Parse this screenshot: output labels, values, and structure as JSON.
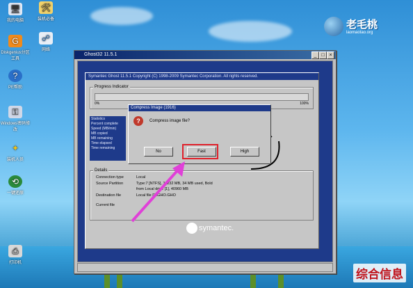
{
  "desktop": {
    "icons": [
      {
        "label": "我的电脑",
        "icon": "computer-icon"
      },
      {
        "label": "装机必备",
        "icon": "tools-icon"
      },
      {
        "label": "Diskgenius分区工具",
        "icon": "disk-icon"
      },
      {
        "label": "网络",
        "icon": "network-icon"
      },
      {
        "label": "PE帮助",
        "icon": "help-icon"
      },
      {
        "label": "Windows密码修改",
        "icon": "key-icon"
      },
      {
        "label": "装机人员",
        "icon": "user-icon"
      },
      {
        "label": "一键还原",
        "icon": "restore-icon"
      },
      {
        "label": "打印机",
        "icon": "printer-icon"
      }
    ]
  },
  "brand": {
    "name": "老毛桃",
    "url": "laomaotao.org"
  },
  "watermark": "综合信息",
  "window": {
    "title": "Ghost32 11.5.1",
    "header": "Symantec Ghost 11.5.1  Copyright (C) 1998-2009 Symantec Corporation. All rights reserved.",
    "progress_label": "Progress Indicator",
    "progress_start": "0%",
    "progress_end": "100%",
    "stats_title": "Statistics",
    "stats_items": [
      "Percent complete",
      "Speed (MB/min)",
      "MB copied",
      "MB remaining",
      "Time elapsed",
      "Time remaining"
    ],
    "details_title": "Details",
    "details": [
      {
        "label": "Connection type",
        "value": "Local"
      },
      {
        "label": "Source Partition",
        "value": "Type:7 [NTFS], 11232 MB, 34 MB used, Bold"
      },
      {
        "label": "",
        "value": "from Local drive [1], 40960 MB"
      },
      {
        "label": "Destination file",
        "value": "Local file D:\\GHO.GHO"
      },
      {
        "label": "Current file",
        "value": ""
      }
    ],
    "vendor": "symantec."
  },
  "dialog": {
    "title": "Compress Image (1916)",
    "message": "Compress image file?",
    "buttons": [
      "No",
      "Fast",
      "High"
    ]
  },
  "colors": {
    "highlight": "#e0202a",
    "arrow": "#e040d8",
    "watermark": "#c0121b"
  }
}
